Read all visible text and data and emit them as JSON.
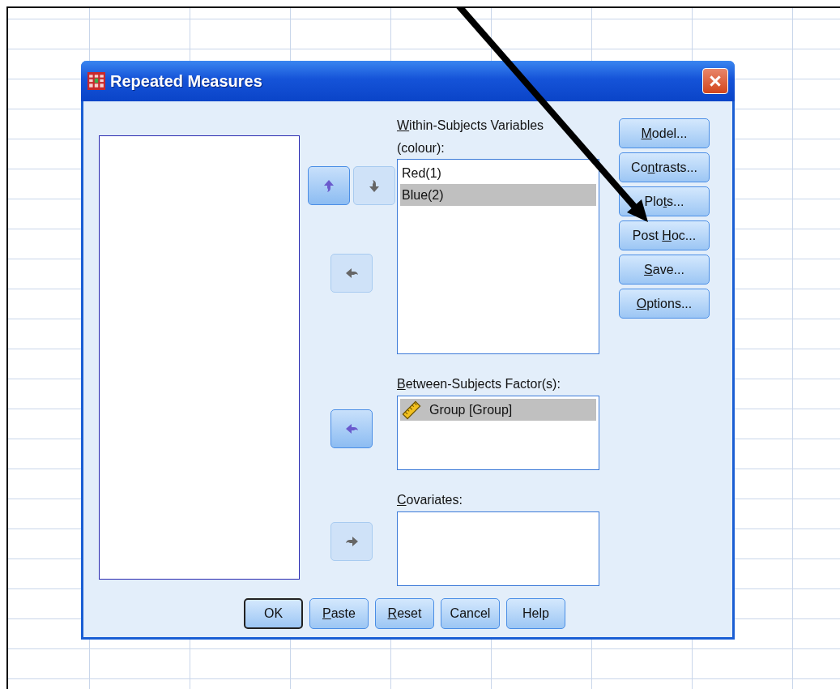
{
  "window": {
    "title": "Repeated Measures"
  },
  "within_subjects": {
    "label": [
      {
        "text": "W",
        "underlined": true
      },
      {
        "text": "ithin-Subjects Variables",
        "underlined": false
      }
    ],
    "factor": "(colour):",
    "items": [
      {
        "text": "Red(1)",
        "selected": false
      },
      {
        "text": "Blue(2)",
        "selected": true
      }
    ]
  },
  "between_subjects": {
    "label": [
      {
        "text": "B",
        "underlined": true
      },
      {
        "text": "etween-Subjects Factor(s):",
        "underlined": false
      }
    ],
    "items": [
      {
        "text": "Group [Group]",
        "selected": true
      }
    ]
  },
  "covariates": {
    "label": [
      {
        "text": "C",
        "underlined": true
      },
      {
        "text": "ovariates:",
        "underlined": false
      }
    ]
  },
  "move_buttons": [
    {
      "kind": "up",
      "disabled": false
    },
    {
      "kind": "down",
      "disabled": true
    },
    {
      "kind": "left",
      "disabled": true
    },
    {
      "kind": "left",
      "disabled": false
    },
    {
      "kind": "right",
      "disabled": true
    }
  ],
  "side_buttons": [
    [
      {
        "text": "M",
        "underlined": true
      },
      {
        "text": "odel...",
        "underlined": false
      }
    ],
    [
      {
        "text": "Co",
        "underlined": false
      },
      {
        "text": "n",
        "underlined": true
      },
      {
        "text": "trasts...",
        "underlined": false
      }
    ],
    [
      {
        "text": "Plo",
        "underlined": false
      },
      {
        "text": "t",
        "underlined": true
      },
      {
        "text": "s...",
        "underlined": false
      }
    ],
    [
      {
        "text": "Post ",
        "underlined": false
      },
      {
        "text": "H",
        "underlined": true
      },
      {
        "text": "oc...",
        "underlined": false
      }
    ],
    [
      {
        "text": "S",
        "underlined": true
      },
      {
        "text": "ave...",
        "underlined": false
      }
    ],
    [
      {
        "text": "O",
        "underlined": true
      },
      {
        "text": "ptions...",
        "underlined": false
      }
    ]
  ],
  "bottom_buttons": [
    {
      "label": [
        {
          "text": "OK",
          "underlined": false
        }
      ],
      "default": true
    },
    {
      "label": [
        {
          "text": "P",
          "underlined": true
        },
        {
          "text": "aste",
          "underlined": false
        }
      ],
      "default": false
    },
    {
      "label": [
        {
          "text": "R",
          "underlined": true
        },
        {
          "text": "eset",
          "underlined": false
        }
      ],
      "default": false
    },
    {
      "label": [
        {
          "text": "Cancel",
          "underlined": false
        }
      ],
      "default": false
    },
    {
      "label": [
        {
          "text": "Help",
          "underlined": false
        }
      ],
      "default": false
    }
  ]
}
